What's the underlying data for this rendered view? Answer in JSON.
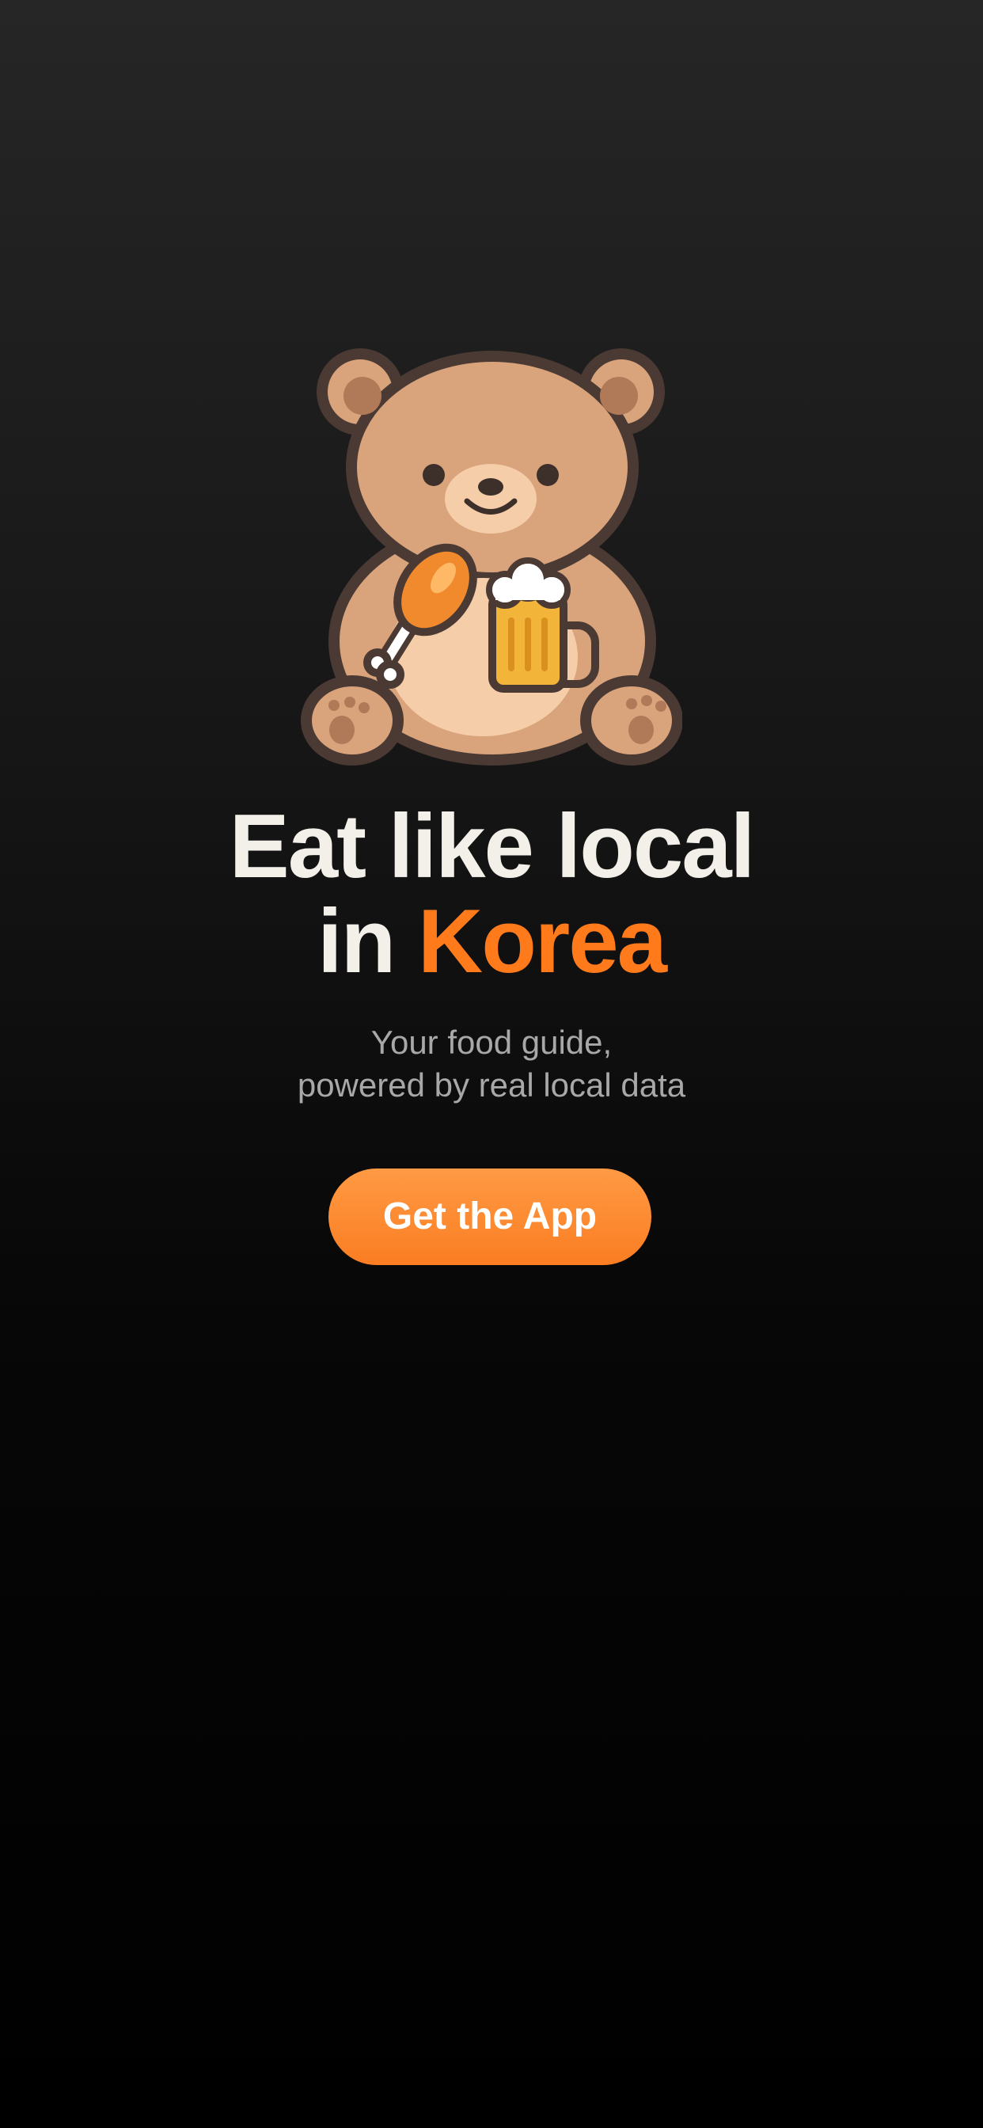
{
  "hero": {
    "headline_line1": "Eat like local",
    "headline_line2_prefix": "in ",
    "headline_line2_accent": "Korea",
    "subtitle_line1": "Your food guide,",
    "subtitle_line2": "powered by real local data"
  },
  "cta": {
    "label": "Get the App"
  },
  "mascot": {
    "icon": "bear-with-chicken-and-beer-icon"
  },
  "colors": {
    "accent": "#ff7a1a",
    "headline": "#f3f0ea",
    "subtitle": "#a8a8a8",
    "button_top": "#ff9a44",
    "button_bottom": "#fa7d22"
  }
}
